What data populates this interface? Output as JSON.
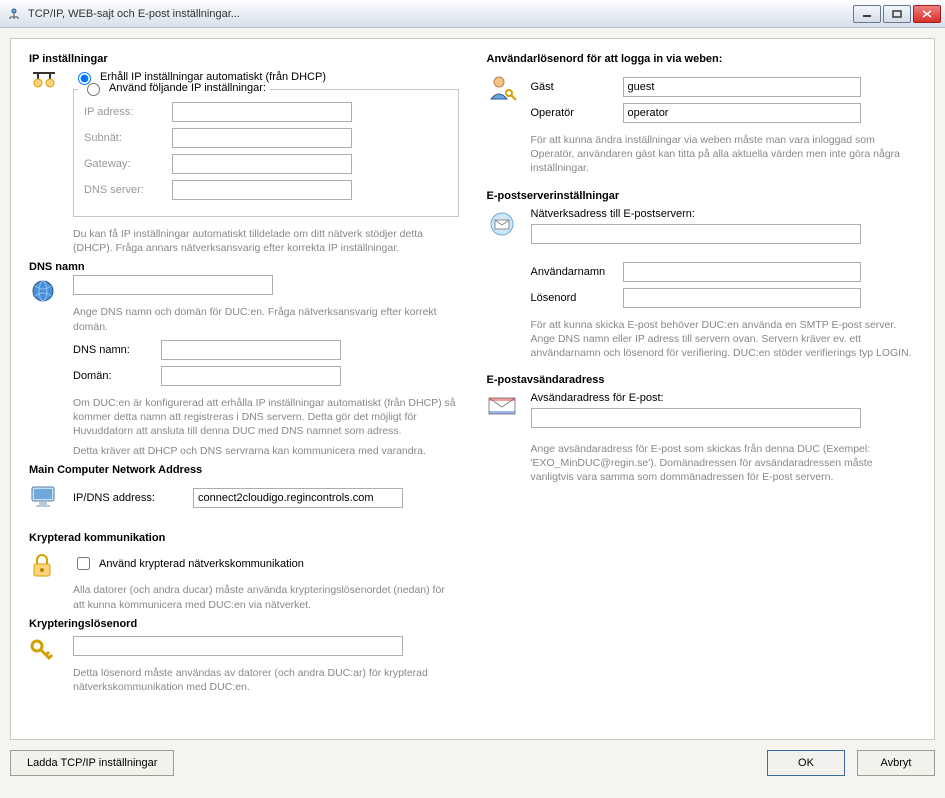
{
  "window": {
    "title": "TCP/IP, WEB-sajt och E-post inställningar..."
  },
  "ip": {
    "title": "IP inställningar",
    "r1": "Erhåll IP inställningar automatiskt (från DHCP)",
    "r2": "Använd följande IP inställningar:",
    "ip_label": "IP adress:",
    "subnet_label": "Subnät:",
    "gateway_label": "Gateway:",
    "dns_label": "DNS server:",
    "help": "Du kan få IP inställningar automatiskt tilldelade om ditt nätverk stödjer detta (DHCP). Fråga annars nätverksansvarig efter korrekta IP inställningar."
  },
  "dns": {
    "title": "DNS namn",
    "help1": "Ange DNS namn och domän för DUC:en. Fråga nätverksansvarig efter korrekt domän.",
    "name_label": "DNS namn:",
    "domain_label": "Domän:",
    "help2": "Om DUC:en är konfigurerad att erhålla IP inställningar automatiskt (från DHCP) så kommer detta namn att registreras i DNS servern. Detta gör det möjligt för Huvuddatorn att ansluta till denna DUC med DNS namnet som adress.",
    "help3": "Detta kräver att DHCP och DNS servrarna kan kommunicera med varandra."
  },
  "main_addr": {
    "title": "Main Computer Network Address",
    "label": "IP/DNS address:",
    "value": "connect2cloudigo.regincontrols.com"
  },
  "crypto": {
    "title": "Krypterad kommunikation",
    "cb": "Använd krypterad nätverkskommunikation",
    "help": "Alla datorer (och andra ducar) måste använda krypteringslösenordet (nedan) för att kunna kommunicera med DUC:en via nätverket."
  },
  "crypto_pw": {
    "title": "Krypteringslösenord",
    "help": "Detta lösenord måste användas av datorer (och andra DUC:ar) för krypterad nätverkskommunikation med DUC:en."
  },
  "userpw": {
    "title": "Användarlösenord för att logga in via weben:",
    "guest_label": "Gäst",
    "guest_value": "guest",
    "op_label": "Operatör",
    "op_value": "operator",
    "help": "För att kunna ändra inställningar via weben måste man vara inloggad som Operatör, användaren gäst kan titta på alla aktuella värden men inte göra några inställningar."
  },
  "epost_server": {
    "title": "E-postserverinställningar",
    "addr_label": "Nätverksadress till E-postservern:",
    "user_label": "Användarnamn",
    "pw_label": "Lösenord",
    "help": "För att kunna skicka E-post behöver DUC:en använda en SMTP E-post server. Ange DNS namn eller IP adress till servern ovan. Servern kräver ev. ett användarnamn och lösenord för verifiering. DUC:en stöder verifierings typ LOGIN."
  },
  "epost_sender": {
    "title": "E-postavsändaradress",
    "label": "Avsändaradress för E-post:",
    "help": "Ange avsändaradress för E-post som skickas från denna DUC (Exempel: 'EXO_MinDUC@regin.se'). Domänadressen för avsändaradressen måste vanligtvis vara samma som dommänadressen för E-post servern."
  },
  "buttons": {
    "load": "Ladda TCP/IP inställningar",
    "ok": "OK",
    "cancel": "Avbryt"
  }
}
